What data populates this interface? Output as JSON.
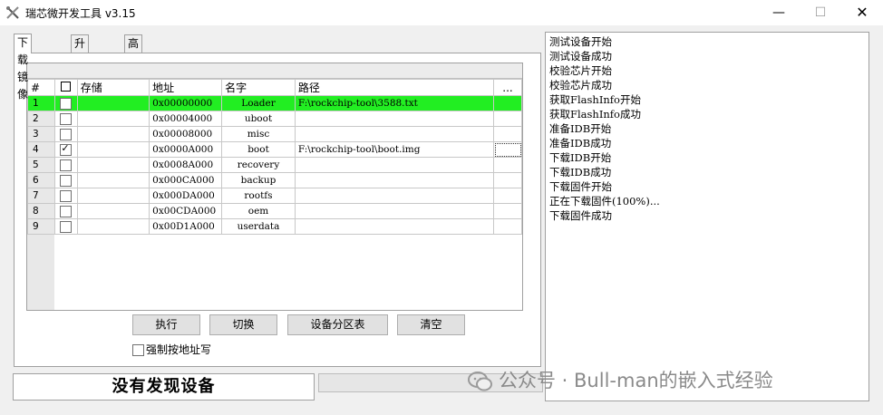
{
  "window": {
    "title": "瑞芯微开发工具 v3.15",
    "min_glyph": "—",
    "max_glyph": "☐",
    "close_glyph": "✕"
  },
  "tabs": [
    {
      "label": "下载镜像",
      "active": true
    },
    {
      "label": "升级固件",
      "active": false
    },
    {
      "label": "高级功能",
      "active": false
    }
  ],
  "grid": {
    "columns": [
      "#",
      "",
      "存储",
      "地址",
      "名字",
      "路径",
      "..."
    ],
    "rows": [
      {
        "num": "1",
        "checked": false,
        "storage": "",
        "address": "0x00000000",
        "name": "Loader",
        "path": "F:\\rockchip-tool\\3588.txt",
        "selected": true
      },
      {
        "num": "2",
        "checked": false,
        "storage": "",
        "address": "0x00004000",
        "name": "uboot",
        "path": "",
        "selected": false
      },
      {
        "num": "3",
        "checked": false,
        "storage": "",
        "address": "0x00008000",
        "name": "misc",
        "path": "",
        "selected": false
      },
      {
        "num": "4",
        "checked": true,
        "storage": "",
        "address": "0x0000A000",
        "name": "boot",
        "path": "F:\\rockchip-tool\\boot.img",
        "selected": false
      },
      {
        "num": "5",
        "checked": false,
        "storage": "",
        "address": "0x0008A000",
        "name": "recovery",
        "path": "",
        "selected": false
      },
      {
        "num": "6",
        "checked": false,
        "storage": "",
        "address": "0x000CA000",
        "name": "backup",
        "path": "",
        "selected": false
      },
      {
        "num": "7",
        "checked": false,
        "storage": "",
        "address": "0x000DA000",
        "name": "rootfs",
        "path": "",
        "selected": false
      },
      {
        "num": "8",
        "checked": false,
        "storage": "",
        "address": "0x00CDA000",
        "name": "oem",
        "path": "",
        "selected": false
      },
      {
        "num": "9",
        "checked": false,
        "storage": "",
        "address": "0x00D1A000",
        "name": "userdata",
        "path": "",
        "selected": false
      }
    ]
  },
  "buttons": {
    "run": "执行",
    "switch": "切换",
    "partition": "设备分区表",
    "clear": "清空"
  },
  "force_write": {
    "label": "强制按地址写",
    "checked": false
  },
  "status": {
    "text": "没有发现设备"
  },
  "log": [
    "测试设备开始",
    "测试设备成功",
    "校验芯片开始",
    "校验芯片成功",
    "获取FlashInfo开始",
    "获取FlashInfo成功",
    "准备IDB开始",
    "准备IDB成功",
    "下载IDB开始",
    "下载IDB成功",
    "下载固件开始",
    "正在下载固件(100%)...",
    "下载固件成功"
  ],
  "watermark": {
    "text": "公众号 · Bull-man的嵌入式经验"
  },
  "colors": {
    "selected_row": "#22ee22"
  }
}
